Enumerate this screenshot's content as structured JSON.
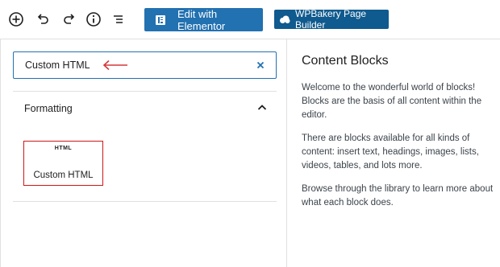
{
  "toolbar": {
    "icons": [
      "add-block-icon",
      "undo-icon",
      "redo-icon",
      "info-icon",
      "list-view-icon"
    ],
    "elementor_label": "Edit with Elementor",
    "wpbakery_label": "WPBakery Page Builder",
    "colors": {
      "primary": "#2271b1",
      "wpbakery": "#0f5a8e"
    }
  },
  "inserter": {
    "search": {
      "value": "Custom HTML"
    },
    "category": {
      "title": "Formatting"
    },
    "blocks": [
      {
        "icon_text": "HTML",
        "label": "Custom HTML"
      }
    ],
    "highlight_color": "#cc1818"
  },
  "preview": {
    "title": "Content Blocks",
    "paragraphs": [
      "Welcome to the wonderful world of blocks! Blocks are the basis of all content within the editor.",
      "There are blocks available for all kinds of content: insert text, headings, images, lists, videos, tables, and lots more.",
      "Browse through the library to learn more about what each block does."
    ]
  }
}
